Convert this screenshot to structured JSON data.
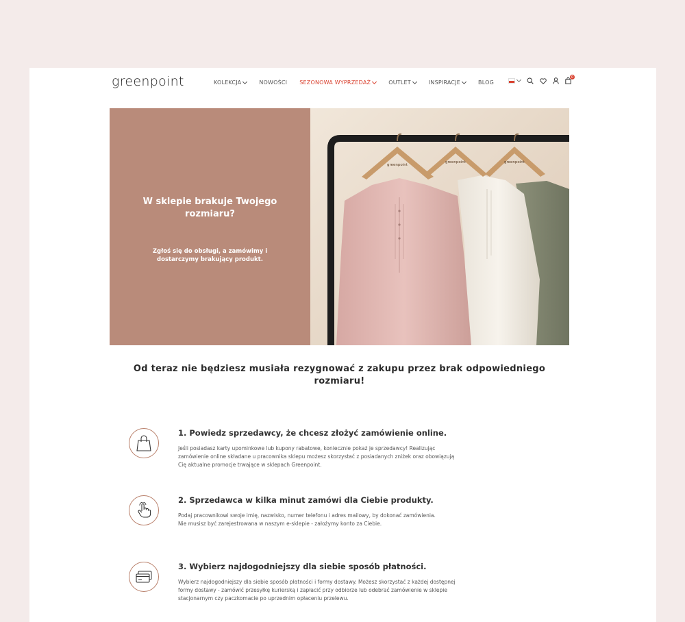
{
  "header": {
    "logo": "greenpoint",
    "nav": [
      {
        "label": "KOLEKCJA",
        "dropdown": true,
        "sale": false
      },
      {
        "label": "NOWOŚCI",
        "dropdown": false,
        "sale": false
      },
      {
        "label": "SEZONOWA WYPRZEDAŻ",
        "dropdown": true,
        "sale": true
      },
      {
        "label": "OUTLET",
        "dropdown": true,
        "sale": false
      },
      {
        "label": "INSPIRACJE",
        "dropdown": true,
        "sale": false
      },
      {
        "label": "BLOG",
        "dropdown": false,
        "sale": false
      }
    ],
    "cart_count": "0",
    "icons": [
      "flag-pl-icon",
      "search-icon",
      "heart-icon",
      "user-icon",
      "cart-icon"
    ]
  },
  "hero": {
    "title": "W sklepie brakuje Twojego rozmiaru?",
    "subtitle": "Zgłoś się do obsługi, a zamówimy i dostarczymy brakujący produkt.",
    "hanger_brand": "greenpoint"
  },
  "tagline": "Od teraz nie będziesz musiała rezygnować z zakupu przez brak odpowiedniego rozmiaru!",
  "steps": [
    {
      "title": "1. Powiedz sprzedawcy, że chcesz złożyć zamówienie online.",
      "lines": [
        "Jeśli posiadasz karty upominkowe lub kupony rabatowe, koniecznie pokaż je sprzedawcy! Realizując",
        "zamówienie online składane u pracownika sklepu możesz skorzystać z posiadanych zniżek oraz obowiązują",
        "Cię aktualne promocje trwające w sklepach Greenpoint."
      ],
      "icon": "shopping-bag-icon"
    },
    {
      "title": "2. Sprzedawca w kilka minut zamówi dla Ciebie produkty.",
      "lines": [
        "Podaj pracownikowi swoje imię, nazwisko, numer telefonu i adres mailowy, by dokonać zamówienia.",
        "Nie musisz być zarejestrowana w naszym e-sklepie - założymy konto za Ciebie."
      ],
      "icon": "hand-pointer-icon"
    },
    {
      "title": "3. Wybierz najdogodniejszy dla siebie sposób płatności.",
      "lines": [
        "Wybierz najdogodniejszy dla siebie sposób płatności i formy dostawy. Możesz skorzystać z każdej dostępnej",
        "formy dostawy - zamówić przesyłkę kurierską i zapłacić przy odbiorze lub odebrać zamówienie w sklepie",
        "stacjonarnym czy paczkomacie po uprzednim opłaceniu przelewu."
      ],
      "icon": "credit-card-icon"
    }
  ],
  "colors": {
    "background": "#f4ebea",
    "accent": "#d9412f",
    "hero_panel": "#b98b7a",
    "icon_ring": "#b9806b"
  }
}
